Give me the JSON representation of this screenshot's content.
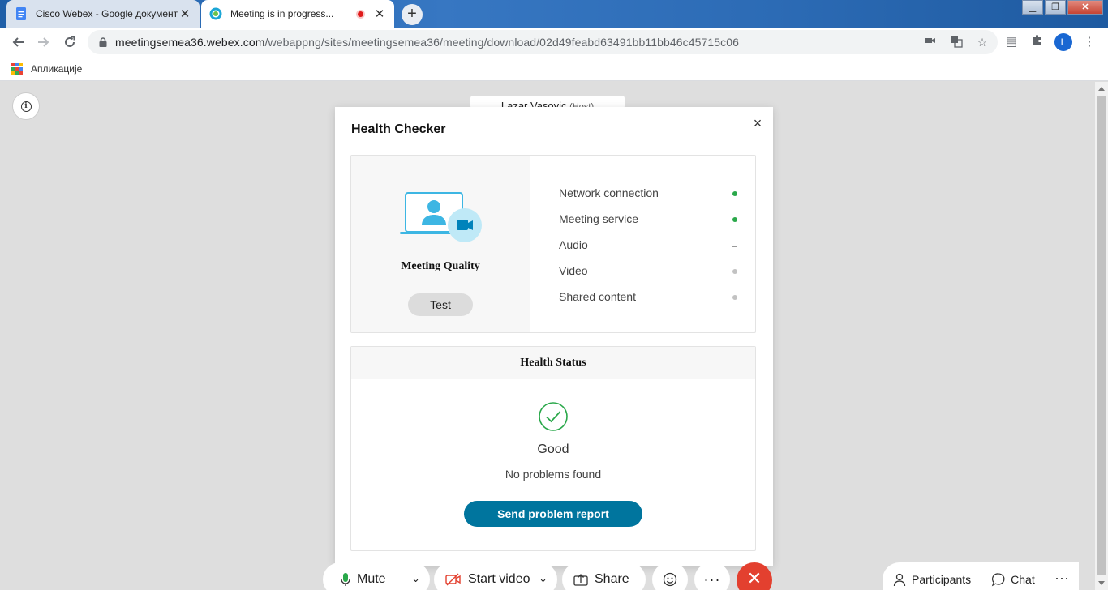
{
  "browser": {
    "tabs": [
      {
        "title": "Cisco Webex - Google документи",
        "active": false
      },
      {
        "title": "Meeting is in progress...",
        "active": true
      }
    ],
    "window_controls": {
      "minimize": "▁",
      "maximize": "❐",
      "close": "✕"
    },
    "url_host": "meetingsemea36.webex.com",
    "url_path": "/webappng/sites/meetingsemea36/meeting/download/02d49feabd63491bb11bb46c45715c06",
    "profile_initial": "L",
    "bookmarks_apps_label": "Апликације"
  },
  "host_tag": {
    "name": "Lazar Vasovic",
    "role": "(Host)"
  },
  "health_checker": {
    "title": "Health Checker",
    "close": "×",
    "quality_label": "Meeting Quality",
    "test_button": "Test",
    "checks": [
      {
        "label": "Network connection",
        "status": "green"
      },
      {
        "label": "Meeting service",
        "status": "green"
      },
      {
        "label": "Audio",
        "status": "dash"
      },
      {
        "label": "Video",
        "status": "grey"
      },
      {
        "label": "Shared content",
        "status": "grey"
      }
    ],
    "status_header": "Health Status",
    "status_word": "Good",
    "status_desc": "No problems found",
    "report_button": "Send problem report"
  },
  "controls": {
    "mute": "Mute",
    "start_video": "Start video",
    "share": "Share",
    "more": "···",
    "leave": "✕",
    "participants": "Participants",
    "chat": "Chat",
    "panel_more": "···"
  },
  "colors": {
    "accent_button": "#00759e",
    "status_good": "#2aa84a",
    "leave_red": "#e3402f",
    "illustration_blue": "#3db6e3"
  }
}
